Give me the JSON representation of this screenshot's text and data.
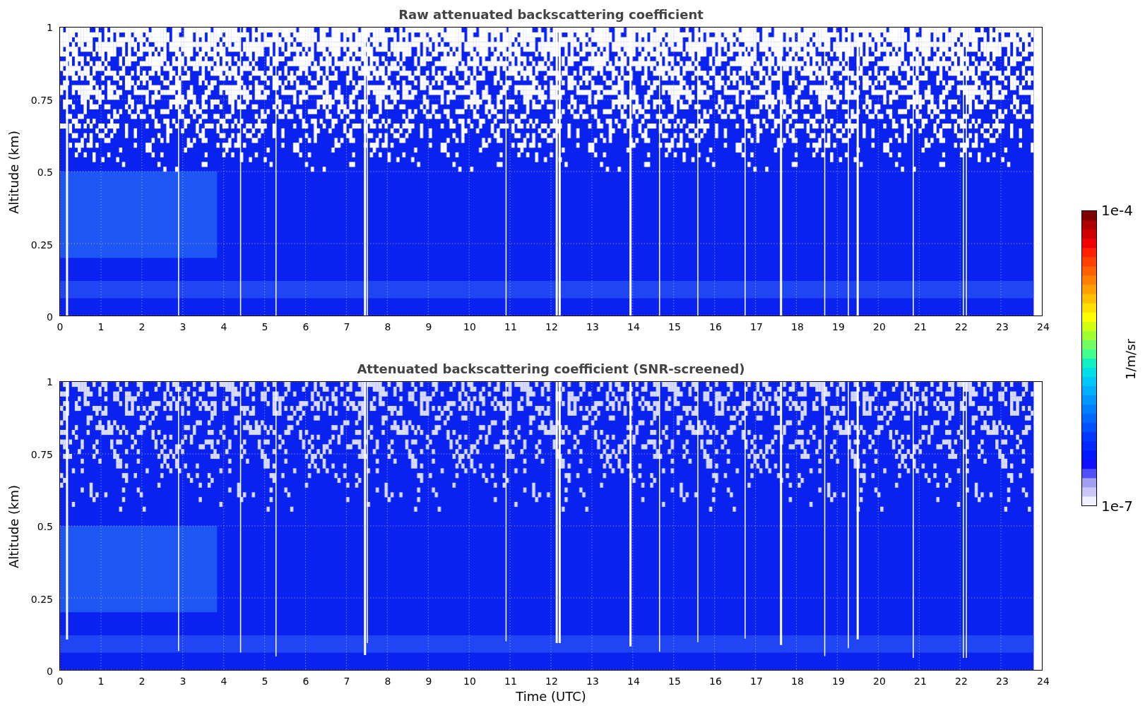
{
  "panels": [
    {
      "kind": "raw",
      "title": "Raw attenuated backscattering coefficient",
      "ylabel": "Altitude (km)",
      "yticks": [
        "1",
        "0.75",
        "0.5",
        "0.25",
        "0"
      ],
      "xticks": [
        "0",
        "1",
        "2",
        "3",
        "4",
        "5",
        "6",
        "7",
        "8",
        "9",
        "10",
        "11",
        "12",
        "13",
        "14",
        "15",
        "16",
        "17",
        "18",
        "19",
        "20",
        "21",
        "22",
        "23",
        "24"
      ]
    },
    {
      "kind": "screened",
      "title": "Attenuated backscattering coefficient (SNR-screened)",
      "ylabel": "Altitude (km)",
      "yticks": [
        "1",
        "0.75",
        "0.5",
        "0.25",
        "0"
      ],
      "xticks": [
        "0",
        "1",
        "2",
        "3",
        "4",
        "5",
        "6",
        "7",
        "8",
        "9",
        "10",
        "11",
        "12",
        "13",
        "14",
        "15",
        "16",
        "17",
        "18",
        "19",
        "20",
        "21",
        "22",
        "23",
        "24"
      ],
      "xlabel": "Time (UTC)"
    }
  ],
  "colorbar": {
    "label": "1/m/sr",
    "max_label": "1e-4",
    "min_label": "1e-7"
  }
}
